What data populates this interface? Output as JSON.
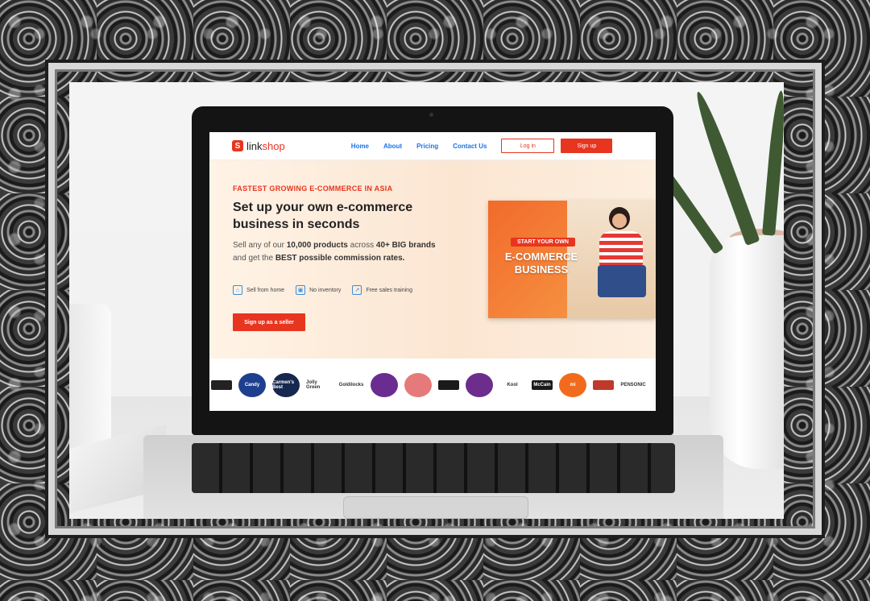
{
  "website": {
    "logo": {
      "mark": "S",
      "text_main": "link",
      "text_accent": "shop"
    },
    "nav": [
      "Home",
      "About",
      "Pricing",
      "Contact Us"
    ],
    "login_label": "Log in",
    "signup_label": "Sign up",
    "hero": {
      "eyebrow": "FASTEST GROWING E-COMMERCE IN ASIA",
      "headline": "Set up your own e-commerce business in seconds",
      "desc_1": "Sell any of our ",
      "desc_2": "10,000 products",
      "desc_3": " across ",
      "desc_4": "40+ BIG brands",
      "desc_5": " and get the ",
      "desc_6": "BEST possible commission rates.",
      "features": [
        {
          "icon": "home-icon",
          "label": "Sell from home"
        },
        {
          "icon": "box-icon",
          "label": "No inventory"
        },
        {
          "icon": "chart-icon",
          "label": "Free sales training"
        }
      ],
      "cta": "Sign up as a seller"
    },
    "promo": {
      "tag": "START YOUR OWN",
      "title": "E-COMMERCE BUSINESS"
    },
    "brands": [
      {
        "label": "",
        "color": "#222222",
        "shape": "rect"
      },
      {
        "label": "Candy",
        "color": "#1e3f8f",
        "shape": "circle"
      },
      {
        "label": "Carmen's Best",
        "color": "#17284f",
        "shape": "circle"
      },
      {
        "label": "Jolly Green",
        "color": "#ffffff",
        "shape": "plain"
      },
      {
        "label": "Goldilocks",
        "color": "#ffffff",
        "shape": "plain"
      },
      {
        "label": "",
        "color": "#6a2c91",
        "shape": "circle"
      },
      {
        "label": "",
        "color": "#e67a7a",
        "shape": "circle"
      },
      {
        "label": "",
        "color": "#1a1a1a",
        "shape": "rect"
      },
      {
        "label": "",
        "color": "#6d2d8c",
        "shape": "circle"
      },
      {
        "label": "Kool",
        "color": "#ffffff",
        "shape": "plain"
      },
      {
        "label": "McCain",
        "color": "#1a1a1a",
        "shape": "rect"
      },
      {
        "label": "mi",
        "color": "#f26b1d",
        "shape": "circle"
      },
      {
        "label": "",
        "color": "#c0392b",
        "shape": "rect"
      },
      {
        "label": "PENSONIC",
        "color": "#ffffff",
        "shape": "plain"
      }
    ]
  }
}
